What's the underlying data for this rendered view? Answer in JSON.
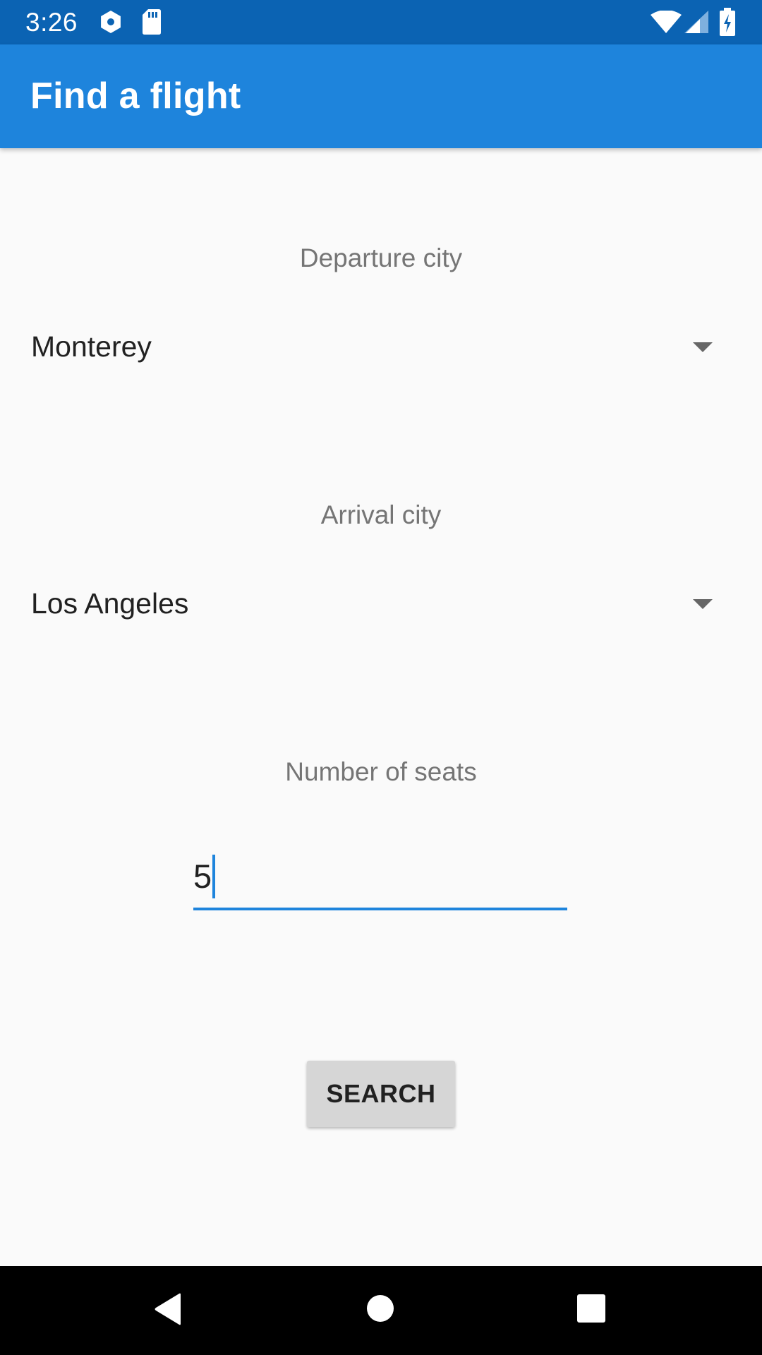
{
  "status_bar": {
    "time": "3:26",
    "icons": [
      "settings-icon",
      "sd-card-icon",
      "wifi-icon",
      "signal-icon",
      "battery-charging-icon"
    ],
    "background": "#0b63b3"
  },
  "app_bar": {
    "title": "Find a flight",
    "background": "#1e84dc"
  },
  "form": {
    "departure": {
      "label": "Departure city",
      "selected": "Monterey",
      "icon": "dropdown-arrow-icon"
    },
    "arrival": {
      "label": "Arrival city",
      "selected": "Los Angeles",
      "icon": "dropdown-arrow-icon"
    },
    "seats": {
      "label": "Number of seats",
      "value": "5",
      "accent": "#1e84dc"
    },
    "search_label": "SEARCH"
  },
  "nav_bar": {
    "icons": [
      "back-icon",
      "home-icon",
      "recents-icon"
    ]
  }
}
